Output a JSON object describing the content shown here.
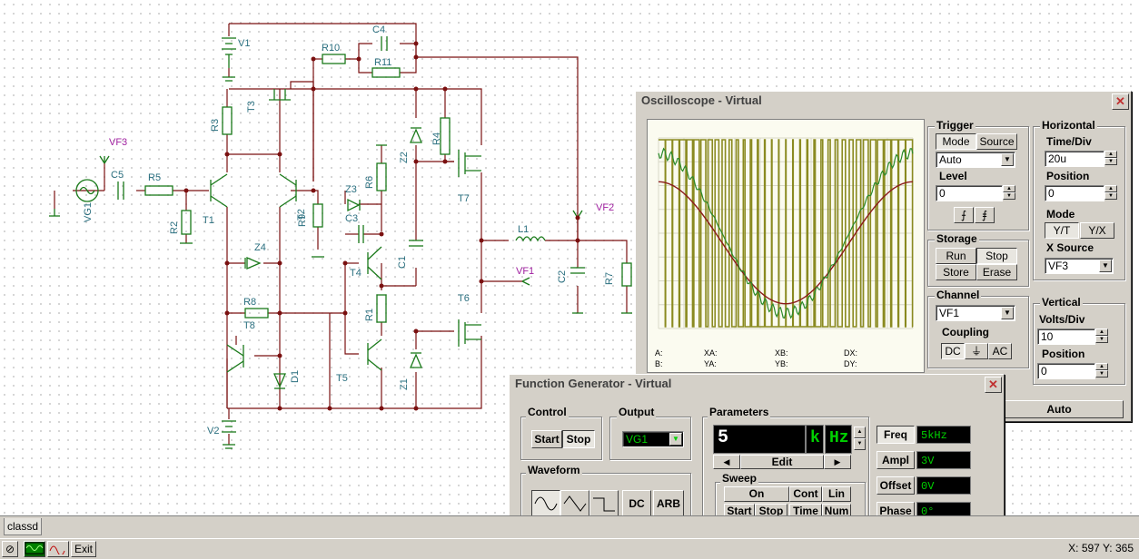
{
  "schematic": {
    "labels": {
      "V1": "V1",
      "V2": "V2",
      "VG1": "VG1",
      "VF1": "VF1",
      "VF2": "VF2",
      "VF3": "VF3",
      "R1": "R1",
      "R2": "R2",
      "R3": "R3",
      "R4": "R4",
      "R5": "R5",
      "R6": "R6",
      "R7": "R7",
      "R8": "R8",
      "R9": "R9",
      "R10": "R10",
      "R11": "R11",
      "C1": "C1",
      "C2": "C2",
      "C3": "C3",
      "C4": "C4",
      "C5": "C5",
      "T1": "T1",
      "T2": "T2",
      "T3": "T3",
      "T4": "T4",
      "T5": "T5",
      "T6": "T6",
      "T7": "T7",
      "T8": "T8",
      "Z1": "Z1",
      "Z2": "Z2",
      "Z3": "Z3",
      "Z4": "Z4",
      "D1": "D1",
      "L1": "L1"
    }
  },
  "oscilloscope": {
    "title": "Oscilloscope - Virtual",
    "readouts": {
      "A": "A:",
      "B": "B:",
      "XA": "XA:",
      "YA": "YA:",
      "XB": "XB:",
      "YB": "YB:",
      "DX": "DX:",
      "DY": "DY:"
    },
    "trigger": {
      "label": "Trigger",
      "mode": "Mode",
      "source": "Source",
      "mode_value": "Auto",
      "level_label": "Level",
      "level_value": "0"
    },
    "horizontal": {
      "label": "Horizontal",
      "timediv_label": "Time/Div",
      "timediv_value": "20u",
      "position_label": "Position",
      "position_value": "0",
      "mode_label": "Mode",
      "yt": "Y/T",
      "yx": "Y/X",
      "xsource_label": "X Source",
      "xsource_value": "VF3"
    },
    "storage": {
      "label": "Storage",
      "run": "Run",
      "stop": "Stop",
      "store": "Store",
      "erase": "Erase"
    },
    "channel": {
      "label": "Channel",
      "value": "VF1",
      "coupling_label": "Coupling",
      "dc": "DC",
      "gnd": "⏚",
      "ac": "AC"
    },
    "vertical": {
      "label": "Vertical",
      "voltsdiv_label": "Volts/Div",
      "voltsdiv_value": "10",
      "position_label": "Position",
      "position_value": "0"
    },
    "auto": "Auto",
    "colors": {
      "pwm": "#8a8a20",
      "ref": "#8b1a1a",
      "output": "#2a8a2a",
      "screen_bg": "#fbfbf0",
      "grid": "#d8d8c8"
    }
  },
  "function_generator": {
    "title": "Function Generator - Virtual",
    "control": {
      "label": "Control",
      "start": "Start",
      "stop": "Stop"
    },
    "output": {
      "label": "Output",
      "value": "VG1"
    },
    "parameters": {
      "label": "Parameters",
      "display_value": "5",
      "display_prefix": "k",
      "display_unit": "Hz",
      "edit": "Edit"
    },
    "sweep": {
      "label": "Sweep",
      "on": "On",
      "cont": "Cont",
      "lin": "Lin",
      "start": "Start",
      "stop": "Stop",
      "time": "Time",
      "num": "Num"
    },
    "waveform": {
      "label": "Waveform",
      "sine": "sine-icon",
      "triangle": "triangle-icon",
      "square": "square-icon",
      "dc": "DC",
      "arb": "ARB"
    },
    "settings": [
      {
        "label": "Freq",
        "value": "5kHz"
      },
      {
        "label": "Ampl",
        "value": "3V"
      },
      {
        "label": "Offset",
        "value": "0V"
      },
      {
        "label": "Phase",
        "value": "0°"
      }
    ]
  },
  "tabs": {
    "active": "classd"
  },
  "statusbar": {
    "exit": "Exit",
    "coords": "X: 597  Y: 365"
  }
}
